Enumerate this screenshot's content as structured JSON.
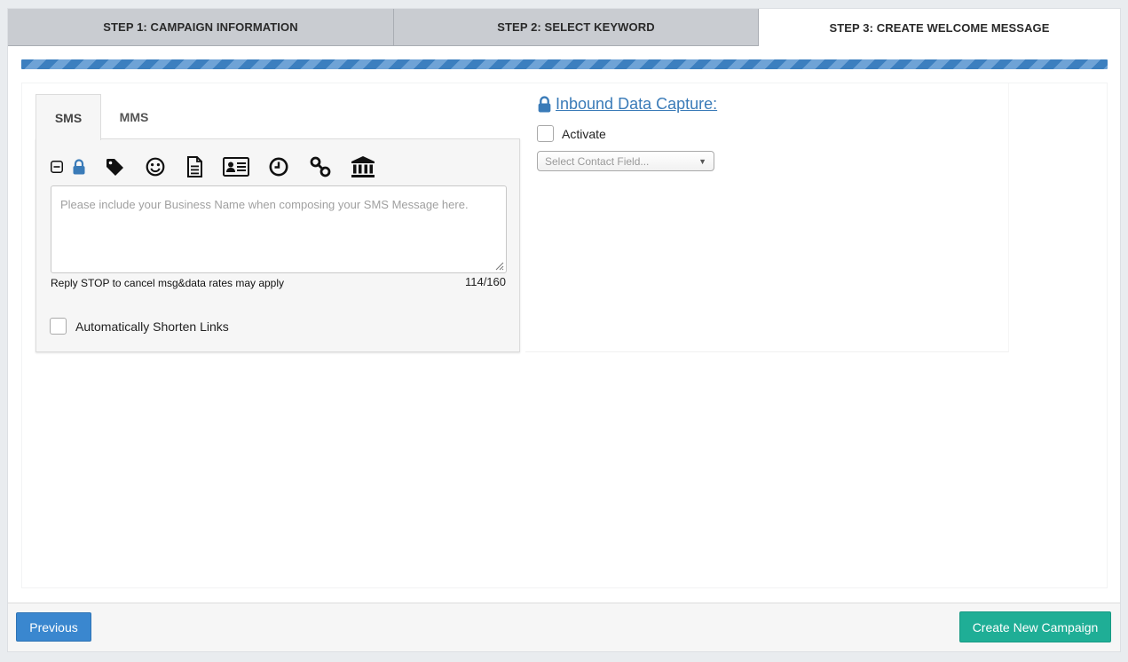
{
  "steps": [
    {
      "label": "STEP 1: CAMPAIGN INFORMATION"
    },
    {
      "label": "STEP 2: SELECT KEYWORD"
    },
    {
      "label": "STEP 3: CREATE WELCOME MESSAGE"
    }
  ],
  "active_step": 3,
  "composer": {
    "tabs": [
      {
        "label": "SMS"
      },
      {
        "label": "MMS"
      }
    ],
    "active_tab": "SMS",
    "toolbar_icons": [
      "collapse-icon",
      "lock-icon",
      "tag-icon",
      "emoji-icon",
      "document-icon",
      "contact-card-icon",
      "clock-icon",
      "link-icon",
      "bank-icon"
    ],
    "message_value": "",
    "message_placeholder": "Please include your Business Name when composing your SMS Message here.",
    "footer_text": "Reply STOP to cancel msg&data rates may apply",
    "char_count": "114/160",
    "shorten_links_label": "Automatically Shorten Links",
    "shorten_links_checked": false
  },
  "inbound": {
    "title": "Inbound Data Capture:",
    "activate_label": "Activate",
    "activate_checked": false,
    "select_placeholder": "Select Contact Field..."
  },
  "footer": {
    "previous_label": "Previous",
    "create_label": "Create New Campaign"
  },
  "colors": {
    "primary": "#3a87cf",
    "success": "#1fae96",
    "link": "#3a7bb8",
    "step_inactive": "#c9ccd1"
  }
}
